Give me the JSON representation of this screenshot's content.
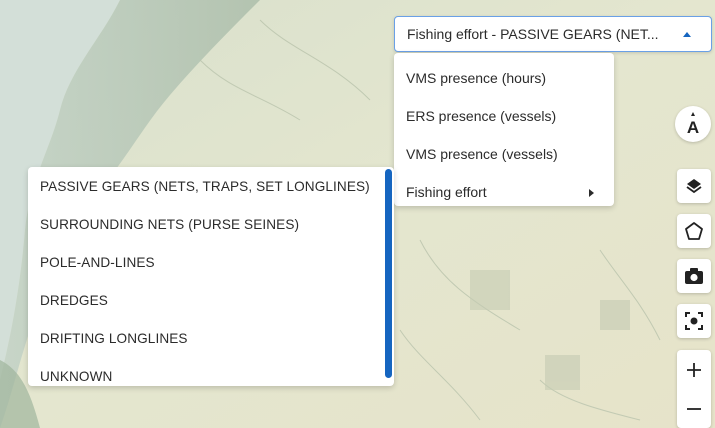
{
  "layer_select": {
    "value": "Fishing effort - PASSIVE GEARS (NET...",
    "caret_icon": "caret-up-icon"
  },
  "layer_menu": {
    "items": [
      {
        "label": "VMS presence (hours)"
      },
      {
        "label": "ERS presence (vessels)"
      },
      {
        "label": "VMS presence (vessels)"
      },
      {
        "label": "Fishing effort",
        "has_submenu": true
      }
    ]
  },
  "gear_menu": {
    "items": [
      {
        "label": "PASSIVE GEARS (NETS, TRAPS, SET LONGLINES)"
      },
      {
        "label": "SURROUNDING NETS (PURSE SEINES)"
      },
      {
        "label": "POLE-AND-LINES"
      },
      {
        "label": "DREDGES"
      },
      {
        "label": "DRIFTING LONGLINES"
      },
      {
        "label": "UNKNOWN"
      }
    ],
    "scrollbar_color": "#1565c0"
  },
  "controls": {
    "compass": {
      "label": "A",
      "icon": "compass-icon"
    },
    "layers": {
      "icon": "layers-icon"
    },
    "polygon": {
      "icon": "polygon-icon"
    },
    "camera": {
      "icon": "camera-icon"
    },
    "focus": {
      "icon": "focus-icon"
    },
    "zoom_in": {
      "label": "+",
      "icon": "plus-icon"
    },
    "zoom_out": {
      "label": "−",
      "icon": "minus-icon"
    }
  },
  "colors": {
    "accent": "#1565c0",
    "select_border": "#6aa0e6",
    "text": "#2b2b2b"
  }
}
